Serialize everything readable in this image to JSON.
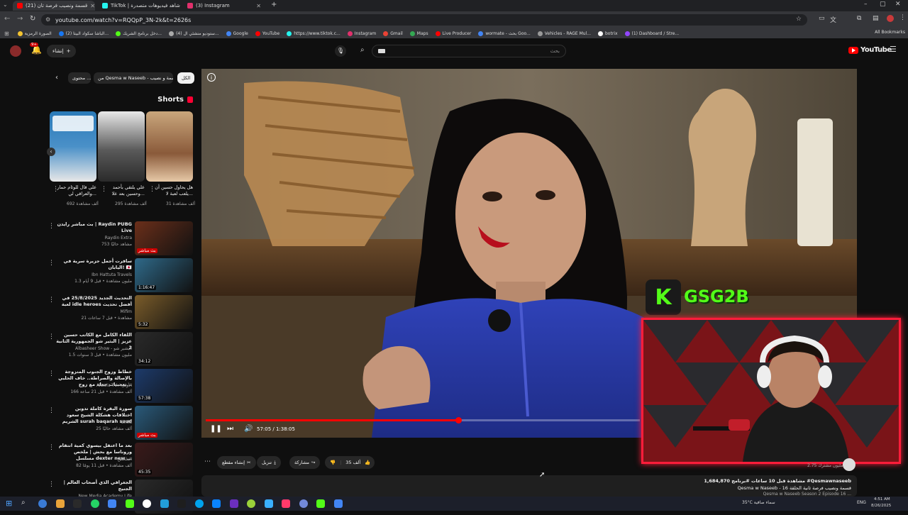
{
  "browser": {
    "tabs": [
      {
        "label": "(21) قسمة ونصيب فرصة تان",
        "active": true,
        "favicon_color": "#ff0000"
      },
      {
        "label": "TikTok | شاهد فيديوهات متصدرة",
        "active": false,
        "favicon_color": "#25f4ee"
      },
      {
        "label": "(3) Instagram",
        "active": false,
        "favicon_color": "#e1306c"
      }
    ],
    "url": "youtube.com/watch?v=RQQpP_3N-2k&t=2626s",
    "bookmarks": [
      {
        "label": "الصورة الرمزية",
        "color": "#f4c430"
      },
      {
        "label": "(2) الباشا سكواد البيتا...",
        "color": "#1877f2"
      },
      {
        "label": "دخل برنامج الشريك...",
        "color": "#53fc18"
      },
      {
        "label": "(4) ستوديو منشئي ال...",
        "color": "#aaaaaa"
      },
      {
        "label": "Google",
        "color": "#4285f4"
      },
      {
        "label": "YouTube",
        "color": "#ff0000"
      },
      {
        "label": "https://www.tiktok.c...",
        "color": "#25f4ee"
      },
      {
        "label": "Instagram",
        "color": "#e1306c"
      },
      {
        "label": "Gmail",
        "color": "#ea4335"
      },
      {
        "label": "Maps",
        "color": "#34a853"
      },
      {
        "label": "Live Producer",
        "color": "#ff0000"
      },
      {
        "label": "wormate - بحث Goo...",
        "color": "#4285f4"
      },
      {
        "label": "Vehicles - RAGE Mul...",
        "color": "#999999"
      },
      {
        "label": "botrix",
        "color": "#ffffff"
      },
      {
        "label": "(1) Dashboard / Stre...",
        "color": "#9146ff"
      }
    ],
    "all_bookmarks": "All Bookmarks"
  },
  "youtube": {
    "create_label": "إنشاء",
    "notif_count": "9+",
    "search_placeholder": "بحث",
    "logo_text": "YouTube",
    "chips": [
      "الكل",
      "من Qesma w Naseeb - قسمة و نصيب",
      "محتوى ..."
    ],
    "shorts_title": "Shorts",
    "shorts": [
      {
        "title": "هل يحاول حسين أن يلعب لعبة لا...",
        "views": "31 ألف مشاهدة"
      },
      {
        "title": "علي يلتقي بأحمد وحسين بعد علا...",
        "views": "295 ألف مشاهدة"
      },
      {
        "title": "علي قال للوئام حمار والعراقي لي...",
        "views": "692 ألف مشاهدة"
      }
    ],
    "related": [
      {
        "title": "بث مباشر رايدن | Raydin PUBG Live",
        "channel": "Raydin Extra",
        "meta": "753 مشاهد حاليًا",
        "duration": "بث مباشر",
        "thumb": "#6b2f1a"
      },
      {
        "title": "سافرت أجمل جزيرة سرية في اليابان! 🇯🇵",
        "channel": "Ibn Hattuta Travels",
        "meta": "1.3 مليون مشاهدة • قبل 9 أيام",
        "duration": "1:16:47",
        "thumb": "#2f6a8a"
      },
      {
        "title": "التحديث الجديد 25/8/2025 في لعبة idle heroes أفضل تحديث",
        "channel": "Mifim",
        "meta": "21 مشاهدة • قبل 7 ساعات",
        "duration": "5:32",
        "thumb": "#7a5c2a"
      },
      {
        "title": "اللقاء الكامل مع الكاتب حسين عزيز | البثير شو الجمهورية الثانية 2",
        "channel": "Albasheer Show - البشير شو",
        "meta": "1.5 مليون مشاهدة • قبل 3 سنوات",
        "duration": "34:12",
        "thumb": "#2a2a2a"
      },
      {
        "title": "خطاط وزوج الجنوب المتزوجة بالإصالة والصراطة.. خاف الحلبي بعجيبات جعله مع زوج...",
        "channel": "Alawla TV - الأولى",
        "meta": "166 ألف مشاهدة • قبل 21 ساعة",
        "duration": "57:38",
        "thumb": "#1d3b6b"
      },
      {
        "title": "سورة البقرة كاملة تدوين اختلافات هشكلة الشيخ سعود الشريم surah baqarah saud",
        "channel": "Shifa",
        "meta": "25 ألف مشاهد حاليًا",
        "duration": "بث مباشر",
        "thumb": "#2a5a7a"
      },
      {
        "title": "بعد ما اعتقل بيسوي كمية انتقام وروناسا مع بحش | ملخص مسلسل dexter new ...",
        "channel": "الملخص",
        "meta": "82 ألف مشاهدة • قبل 11 يومًا",
        "duration": "45:35",
        "thumb": "#3a1a1a"
      },
      {
        "title": "الجغرافي الذي أصحاب العالم | الجنيح",
        "channel": "New Media Academy Life",
        "meta": "",
        "duration": "",
        "thumb": "#2a2a2a"
      }
    ]
  },
  "player": {
    "time": "57:05 / 1:38:05",
    "progress": 0.582,
    "streamer_name": "GSG2B"
  },
  "actions": {
    "likes": "35 ألف",
    "share": "مشاركة",
    "download": "تنزيل",
    "clip": "إنشاء مقطع",
    "subscribers": "2.75 مليون مشترك"
  },
  "description": {
    "stats": "1,684,870 مشاهدة قبل 10 ساعات #برنامج #Qesmawnaseeb",
    "line1": "Qesma w Naseeb - 16 قسمة ونصيب فرصة ثانية الحلقة",
    "line2": "Qesma w Naseeb Season 2 Episode 16 ..."
  },
  "taskbar": {
    "weather": "35°C سماء صافية",
    "lang": "ENG",
    "time": "4:51 AM",
    "date": "8/26/2025"
  }
}
